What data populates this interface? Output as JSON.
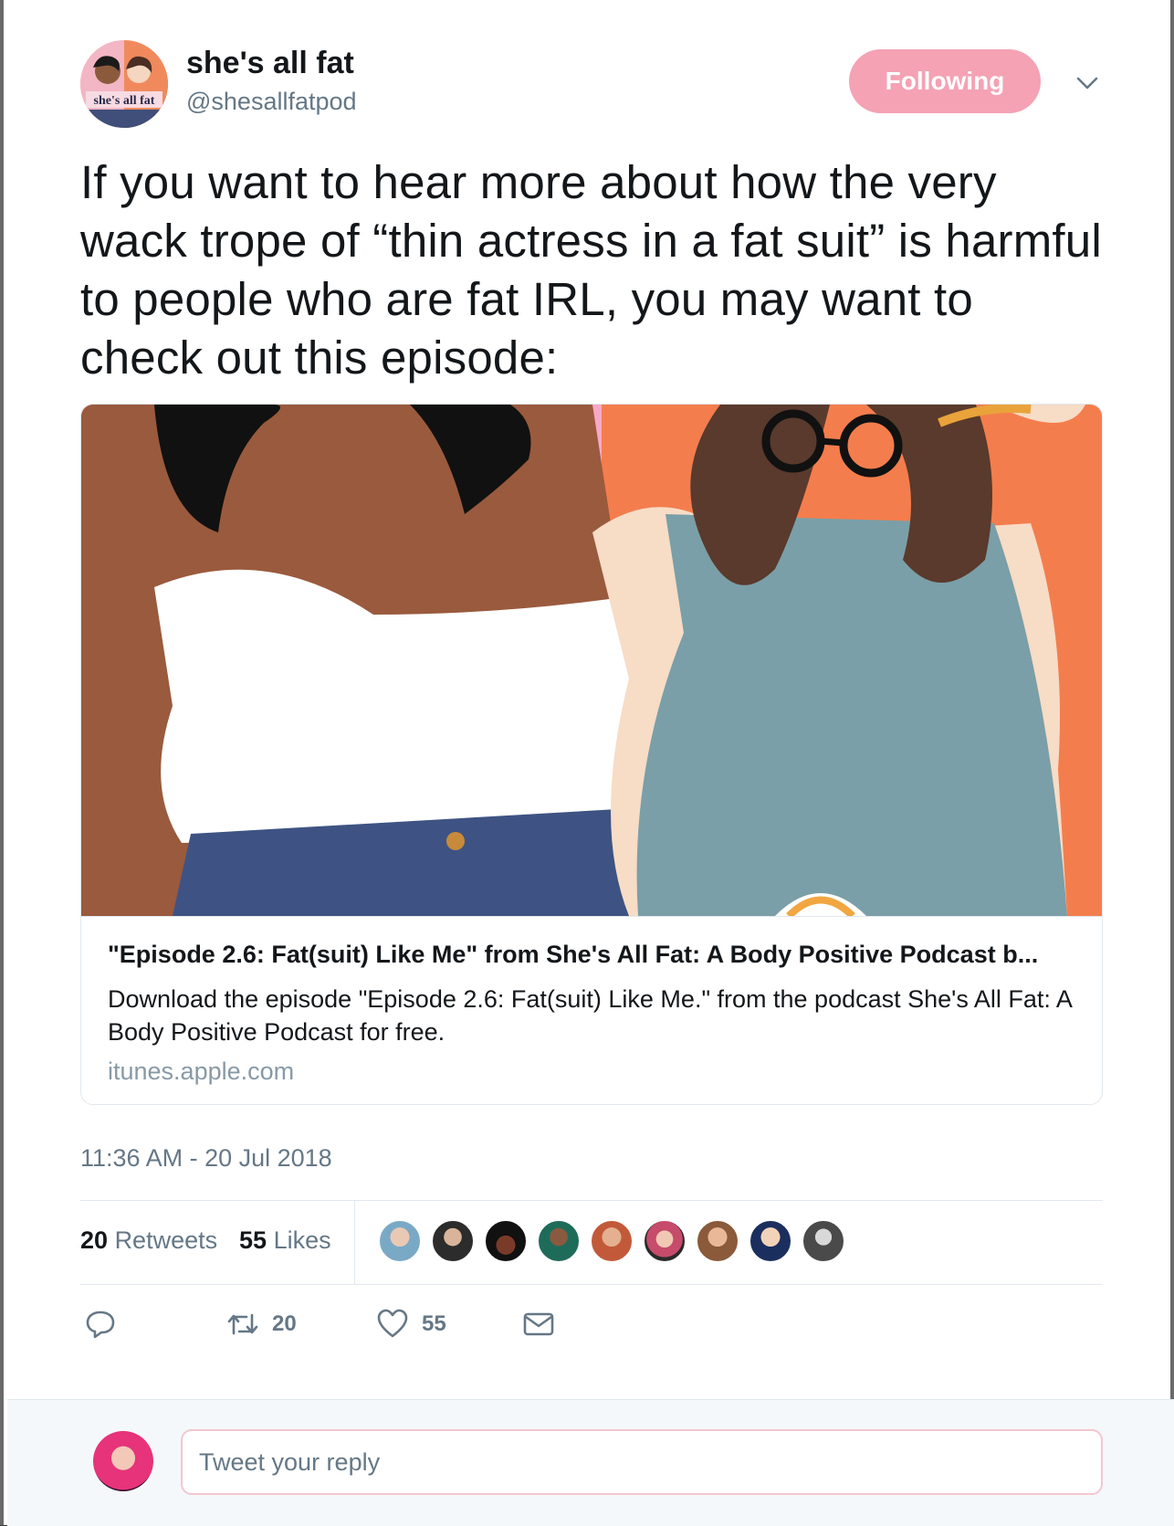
{
  "tweet": {
    "display_name": "she's all fat",
    "handle": "@shesallfatpod",
    "follow_label": "Following",
    "accent_color": "#f4a2b4",
    "text": "If you want to hear more about how the very wack trope of “thin actress in a fat suit” is harmful to people who are fat IRL, you may want to check out this episode:",
    "timestamp": "11:36 AM - 20 Jul 2018"
  },
  "card": {
    "title": "\"Episode 2.6: Fat(suit) Like Me\" from She's All Fat: A Body Positive Podcast b...",
    "description": "Download the episode \"Episode 2.6: Fat(suit) Like Me.\" from the podcast She's All Fat: A Body Positive Podcast for free.",
    "domain": "itunes.apple.com"
  },
  "stats": {
    "retweets_count": "20",
    "retweets_label": "Retweets",
    "likes_count": "55",
    "likes_label": "Likes"
  },
  "actions": {
    "reply_icon": "reply-icon",
    "retweet_icon": "retweet-icon",
    "retweet_count": "20",
    "like_icon": "heart-icon",
    "like_count": "55",
    "dm_icon": "envelope-icon"
  },
  "reply": {
    "placeholder": "Tweet your reply"
  }
}
